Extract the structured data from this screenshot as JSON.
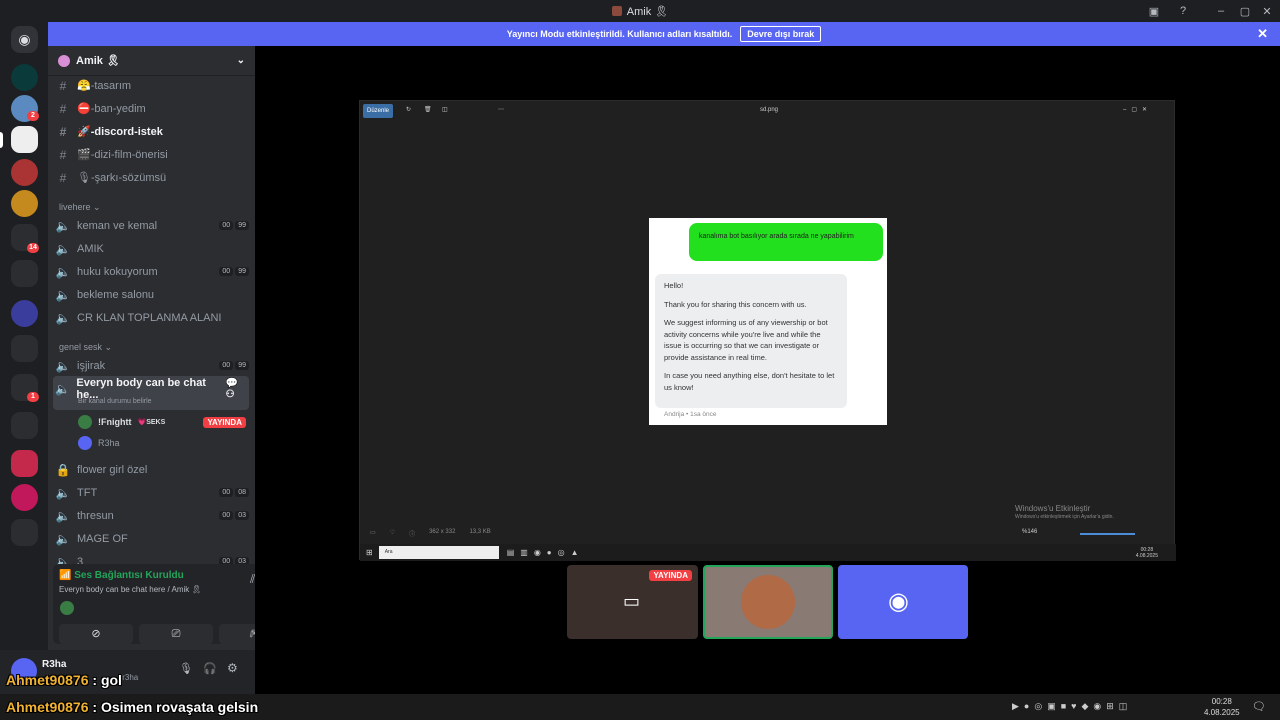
{
  "window": {
    "title": "Amik 🎗"
  },
  "banner": {
    "text": "Yayıncı Modu etkinleştirildi. Kullanıcı adları kısaltıldı.",
    "button": "Devre dışı bırak"
  },
  "server": {
    "name": "Amik 🎗"
  },
  "channels": {
    "text": [
      {
        "name": "😤-tasarım"
      },
      {
        "name": "⛔-ban-yedim"
      },
      {
        "name": "🚀-discord-istek"
      },
      {
        "name": "🎬-dizi-film-önerisi"
      },
      {
        "name": "🎙-şarkı-sözümsü"
      }
    ],
    "cat1": "livehere",
    "voice1": [
      {
        "name": "keman ve kemal",
        "c1": "00",
        "c2": "99"
      },
      {
        "name": "AMIK"
      },
      {
        "name": "huku kokuyorum",
        "c1": "00",
        "c2": "99"
      },
      {
        "name": "bekleme salonu"
      },
      {
        "name": "CR KLAN TOPLANMA ALANI"
      }
    ],
    "cat2": "genel sesk",
    "voice2": [
      {
        "name": "işjirak",
        "c1": "00",
        "c2": "99"
      },
      {
        "name": "Everyn body can be chat he...",
        "status": "Bir kanal durumu belirle"
      }
    ],
    "users": [
      {
        "name": "!Fnightt",
        "tag": "💗SEKS",
        "live": "YAYINDA"
      },
      {
        "name": "R3ha"
      }
    ],
    "voice3": [
      {
        "name": "flower girl özel"
      },
      {
        "name": "TFT",
        "c1": "00",
        "c2": "08"
      },
      {
        "name": "thresun",
        "c1": "00",
        "c2": "03"
      },
      {
        "name": "MAGE OF"
      },
      {
        "name": "3",
        "c1": "00",
        "c2": "03"
      }
    ]
  },
  "voice_panel": {
    "status": "Ses Bağlantısı Kuruldu",
    "channel": "Everyn body can be chat here / Amik 🎗"
  },
  "user_panel": {
    "name": "R3ha",
    "sub": "/r3ha"
  },
  "overlay": [
    {
      "user": "Ahmet90876",
      "msg": " : gol"
    },
    {
      "user": "Ahmet90876",
      "msg": " : Osimen rovaşata gelsin"
    }
  ],
  "stream": {
    "edit_label": "Düzenle",
    "file": "sd.png",
    "green_msg": "kanalıma bot basılıyor arada sırada ne yapabilirim",
    "reply": [
      "Hello!",
      "Thank you for sharing this concern with us.",
      "We suggest informing us of any viewership or bot activity concerns while you're live and while the issue is occurring so that we can investigate or provide assistance in real time.",
      "In case you need anything else, don't hesitate to let us know!"
    ],
    "meta": "Andrija • 1sa önce",
    "dims": "362 x 332",
    "size": "13,3 KB",
    "zoom": "%146",
    "search": "Ara",
    "activate1": "Windows'u Etkinleştir",
    "activate2": "Windows'u etkinleştirmek için Ayarlar'a gidin.",
    "time": "00:28",
    "date": "4.08.2025"
  },
  "tiles": {
    "live": "YAYINDA"
  },
  "taskbar": {
    "time": "00:28",
    "date": "4.08.2025"
  }
}
